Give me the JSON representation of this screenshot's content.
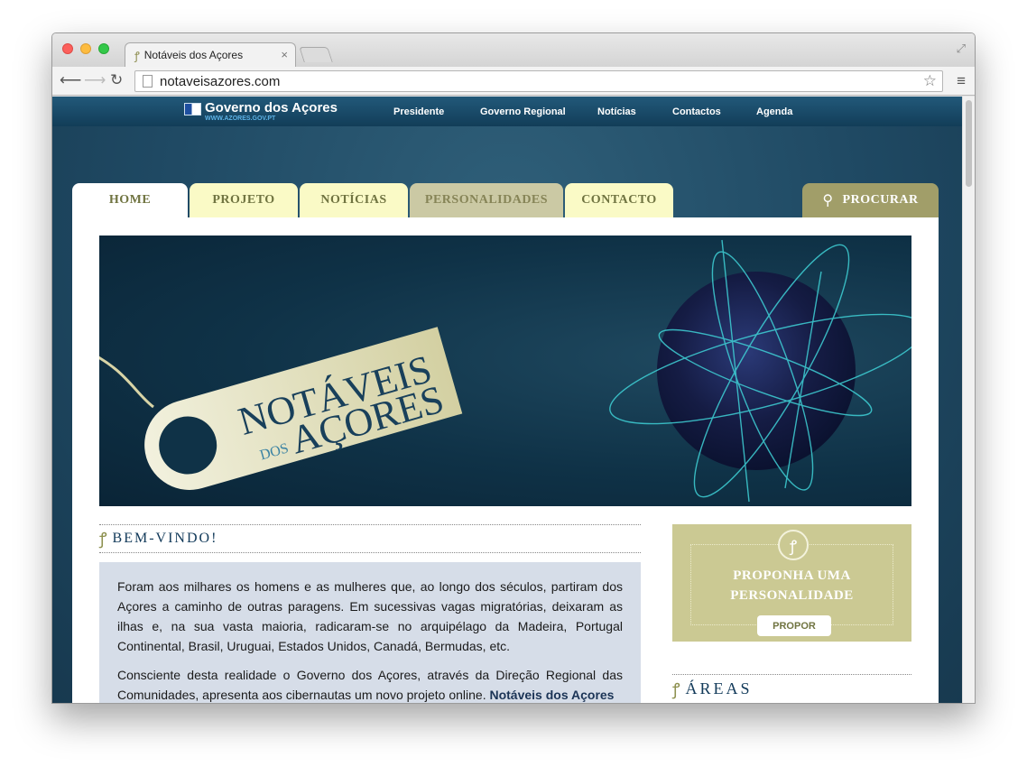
{
  "browser": {
    "tab_title": "Notáveis dos Açores",
    "tab_icon": "ornament-favicon",
    "tab_close": "×",
    "address": "notaveisazores.com"
  },
  "gov_bar": {
    "logo_name": "Governo dos Açores",
    "logo_url": "WWW.AZORES.GOV.PT",
    "links": [
      "Presidente",
      "Governo Regional",
      "Notícias",
      "Contactos",
      "Agenda"
    ]
  },
  "main_nav": {
    "tabs": [
      "HOME",
      "PROJETO",
      "NOTÍCIAS",
      "PERSONALIDADES",
      "CONTACTO"
    ],
    "active_tab": "PERSONALIDADES",
    "search_label": "PROCURAR"
  },
  "banner": {
    "title_line1": "NOTÁVEIS",
    "title_small": "DOS",
    "title_line2": "AÇORES"
  },
  "welcome": {
    "title": "BEM-VINDO!",
    "paragraph1": "Foram aos milhares os homens e as mulheres que, ao longo dos séculos, partiram dos Açores a caminho de outras paragens. Em sucessivas vagas migratórias, deixaram as ilhas e, na sua vasta maioria, radicaram-se no arquipélago da Madeira, Portugal Continental, Brasil, Uruguai, Estados Unidos, Canadá, Bermudas, etc.",
    "paragraph2_start": "Consciente desta realidade o Governo dos Açores, através da Direção Regional das Comunidades, apresenta aos cibernautas um novo projeto online.",
    "paragraph2_bold": "Notáveis dos Açores"
  },
  "propose": {
    "title_line1": "PROPONHA UMA",
    "title_line2": "PERSONALIDADE",
    "button": "PROPOR"
  },
  "areas": {
    "title": "ÁREAS"
  },
  "colors": {
    "page_bg": "#1f4963",
    "nav_cream": "#fafac6",
    "nav_active": "#cbc9a4",
    "search_olive": "#a19e69",
    "propose_bg": "#cbc993",
    "welcome_box": "#d6dde8",
    "heading_navy": "#123a5a"
  }
}
